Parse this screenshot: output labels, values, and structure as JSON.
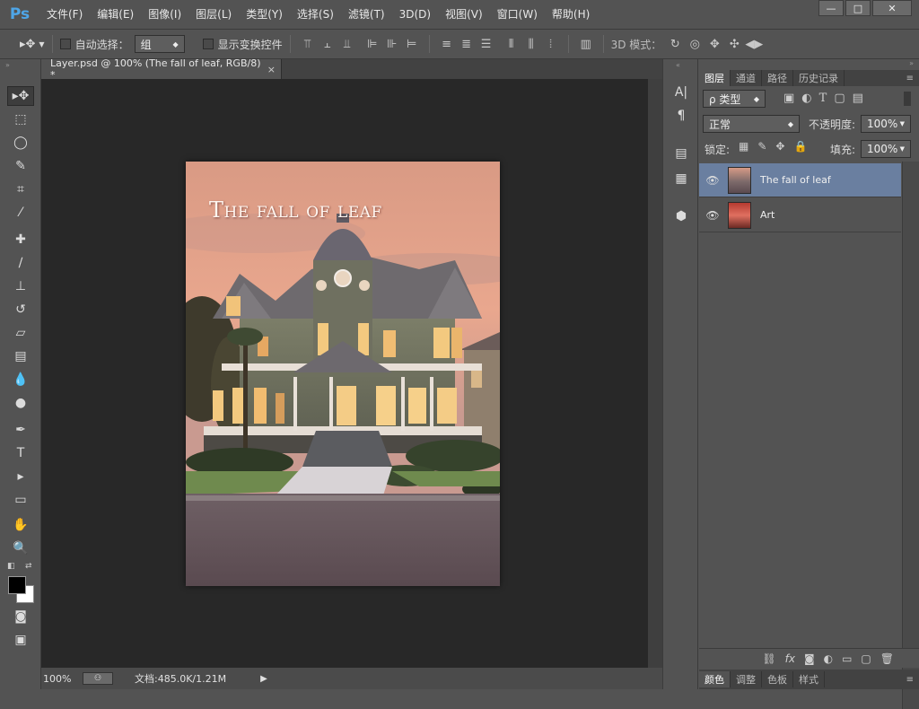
{
  "app": {
    "logo": "Ps"
  },
  "menu": [
    "文件(F)",
    "编辑(E)",
    "图像(I)",
    "图层(L)",
    "类型(Y)",
    "选择(S)",
    "滤镜(T)",
    "3D(D)",
    "视图(V)",
    "窗口(W)",
    "帮助(H)"
  ],
  "window_controls": {
    "minimize": "—",
    "maximize": "□",
    "close": "✕"
  },
  "options": {
    "auto_select_label": "自动选择：",
    "auto_select_value": "组",
    "show_transform_label": "显示变换控件",
    "mode_3d_label": "3D 模式："
  },
  "document": {
    "tab_title": "Layer.psd @ 100% (The fall of leaf, RGB/8) *",
    "tab_close": "×",
    "zoom": "100%",
    "doc_info": "文档:485.0K/1.21M",
    "art_title": "The fall of leaf"
  },
  "panel": {
    "tabs": [
      "图层",
      "通道",
      "路径",
      "历史记录"
    ],
    "filter_label": "ρ 类型",
    "blend_mode": "正常",
    "opacity_label": "不透明度:",
    "opacity_value": "100%",
    "lock_label": "锁定:",
    "fill_label": "填充:",
    "fill_value": "100%",
    "layers": [
      {
        "name": "The fall of leaf",
        "selected": true
      },
      {
        "name": "Art",
        "selected": false
      }
    ],
    "bottom_tabs": [
      "颜色",
      "调整",
      "色板",
      "样式"
    ]
  },
  "colors": {
    "accent_selected_layer": "#6a7fa0",
    "canvas_bg": "#282828",
    "chrome_bg": "#535353"
  }
}
